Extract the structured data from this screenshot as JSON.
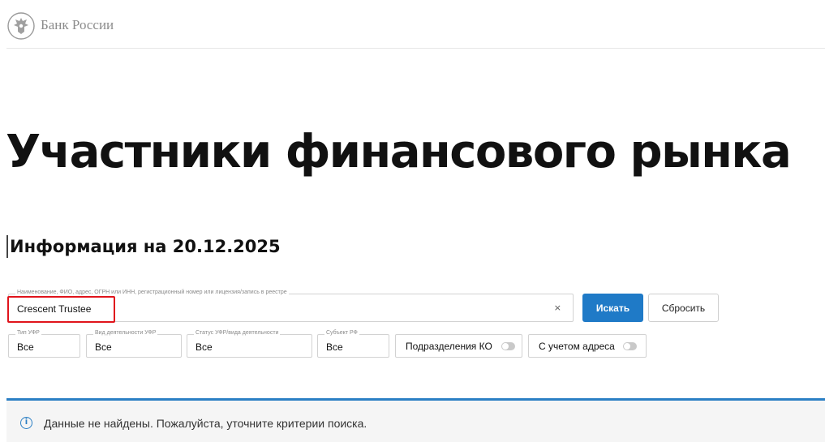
{
  "header": {
    "logo_text": "Банк России",
    "logo_icon": "eagle-emblem-icon"
  },
  "page_title": "Участники финансового рынка",
  "info_title": "Информация на 20.12.2025",
  "search": {
    "label": "Наименование, ФИО, адрес, ОГРН или ИНН, регистрационный номер или лицензия/запись в реестре",
    "value": "Crescent Trustee",
    "clear_icon": "×",
    "search_button": "Искать",
    "reset_button": "Сбросить"
  },
  "filters": [
    {
      "label": "Тип УФР",
      "value": "Все"
    },
    {
      "label": "Вид деятельности УФР",
      "value": "Все"
    },
    {
      "label": "Статус УФР/вида деятельности",
      "value": "Все"
    },
    {
      "label": "Субъект РФ",
      "value": "Все"
    }
  ],
  "toggles": [
    {
      "label": "Подразделения КО",
      "enabled": false
    },
    {
      "label": "С учетом адреса",
      "enabled": false
    }
  ],
  "notice": {
    "icon": "info-icon",
    "text": "Данные не найдены. Пожалуйста, уточните критерии поиска."
  },
  "colors": {
    "accent": "#1f7ac7",
    "highlight": "#e0141c"
  }
}
